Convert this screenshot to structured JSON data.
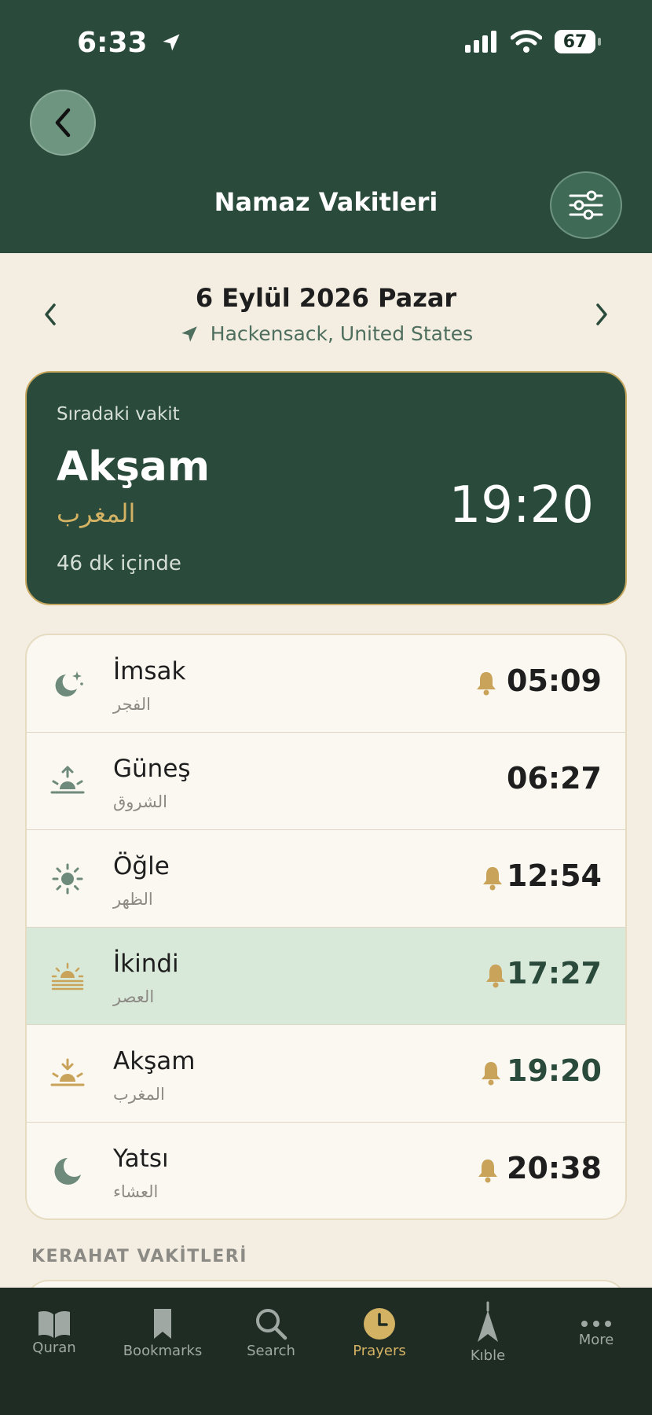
{
  "status_bar": {
    "time": "6:33",
    "battery": "67"
  },
  "header": {
    "title": "Namaz Vakitleri"
  },
  "date_nav": {
    "date": "6 Eylül 2026 Pazar",
    "location": "Hackensack, United States"
  },
  "next_prayer": {
    "label": "Sıradaki vakit",
    "name": "Akşam",
    "arabic": "المغرب",
    "remaining": "46 dk içinde",
    "time": "19:20"
  },
  "prayers": [
    {
      "name": "İmsak",
      "arabic": "الفجر",
      "time": "05:09",
      "icon": "moon-stars-icon",
      "alarm": true
    },
    {
      "name": "Güneş",
      "arabic": "الشروق",
      "time": "06:27",
      "icon": "sunrise-icon",
      "alarm": false
    },
    {
      "name": "Öğle",
      "arabic": "الظهر",
      "time": "12:54",
      "icon": "sun-icon",
      "alarm": true
    },
    {
      "name": "İkindi",
      "arabic": "العصر",
      "time": "17:27",
      "icon": "sun-haze-icon",
      "alarm": true,
      "active": true
    },
    {
      "name": "Akşam",
      "arabic": "المغرب",
      "time": "19:20",
      "icon": "sunset-icon",
      "alarm": true
    },
    {
      "name": "Yatsı",
      "arabic": "العشاء",
      "time": "20:38",
      "icon": "moon-icon",
      "alarm": true
    }
  ],
  "section": {
    "kerahat_title": "KERAHAT VAKİTLERİ"
  },
  "tabbar": {
    "items": [
      {
        "label": "Quran",
        "icon": "book-icon"
      },
      {
        "label": "Bookmarks",
        "icon": "bookmark-icon"
      },
      {
        "label": "Search",
        "icon": "search-icon"
      },
      {
        "label": "Prayers",
        "icon": "clock-icon",
        "active": true
      },
      {
        "label": "Kıble",
        "icon": "qibla-compass-icon"
      },
      {
        "label": "More",
        "icon": "more-dots-icon"
      }
    ]
  },
  "colors": {
    "header_bg": "#2A4B3B",
    "accent_gold": "#C9A35A",
    "page_bg": "#F4EEE2",
    "active_row": "#D8E9DA",
    "tabbar_bg": "#1F2C24"
  }
}
